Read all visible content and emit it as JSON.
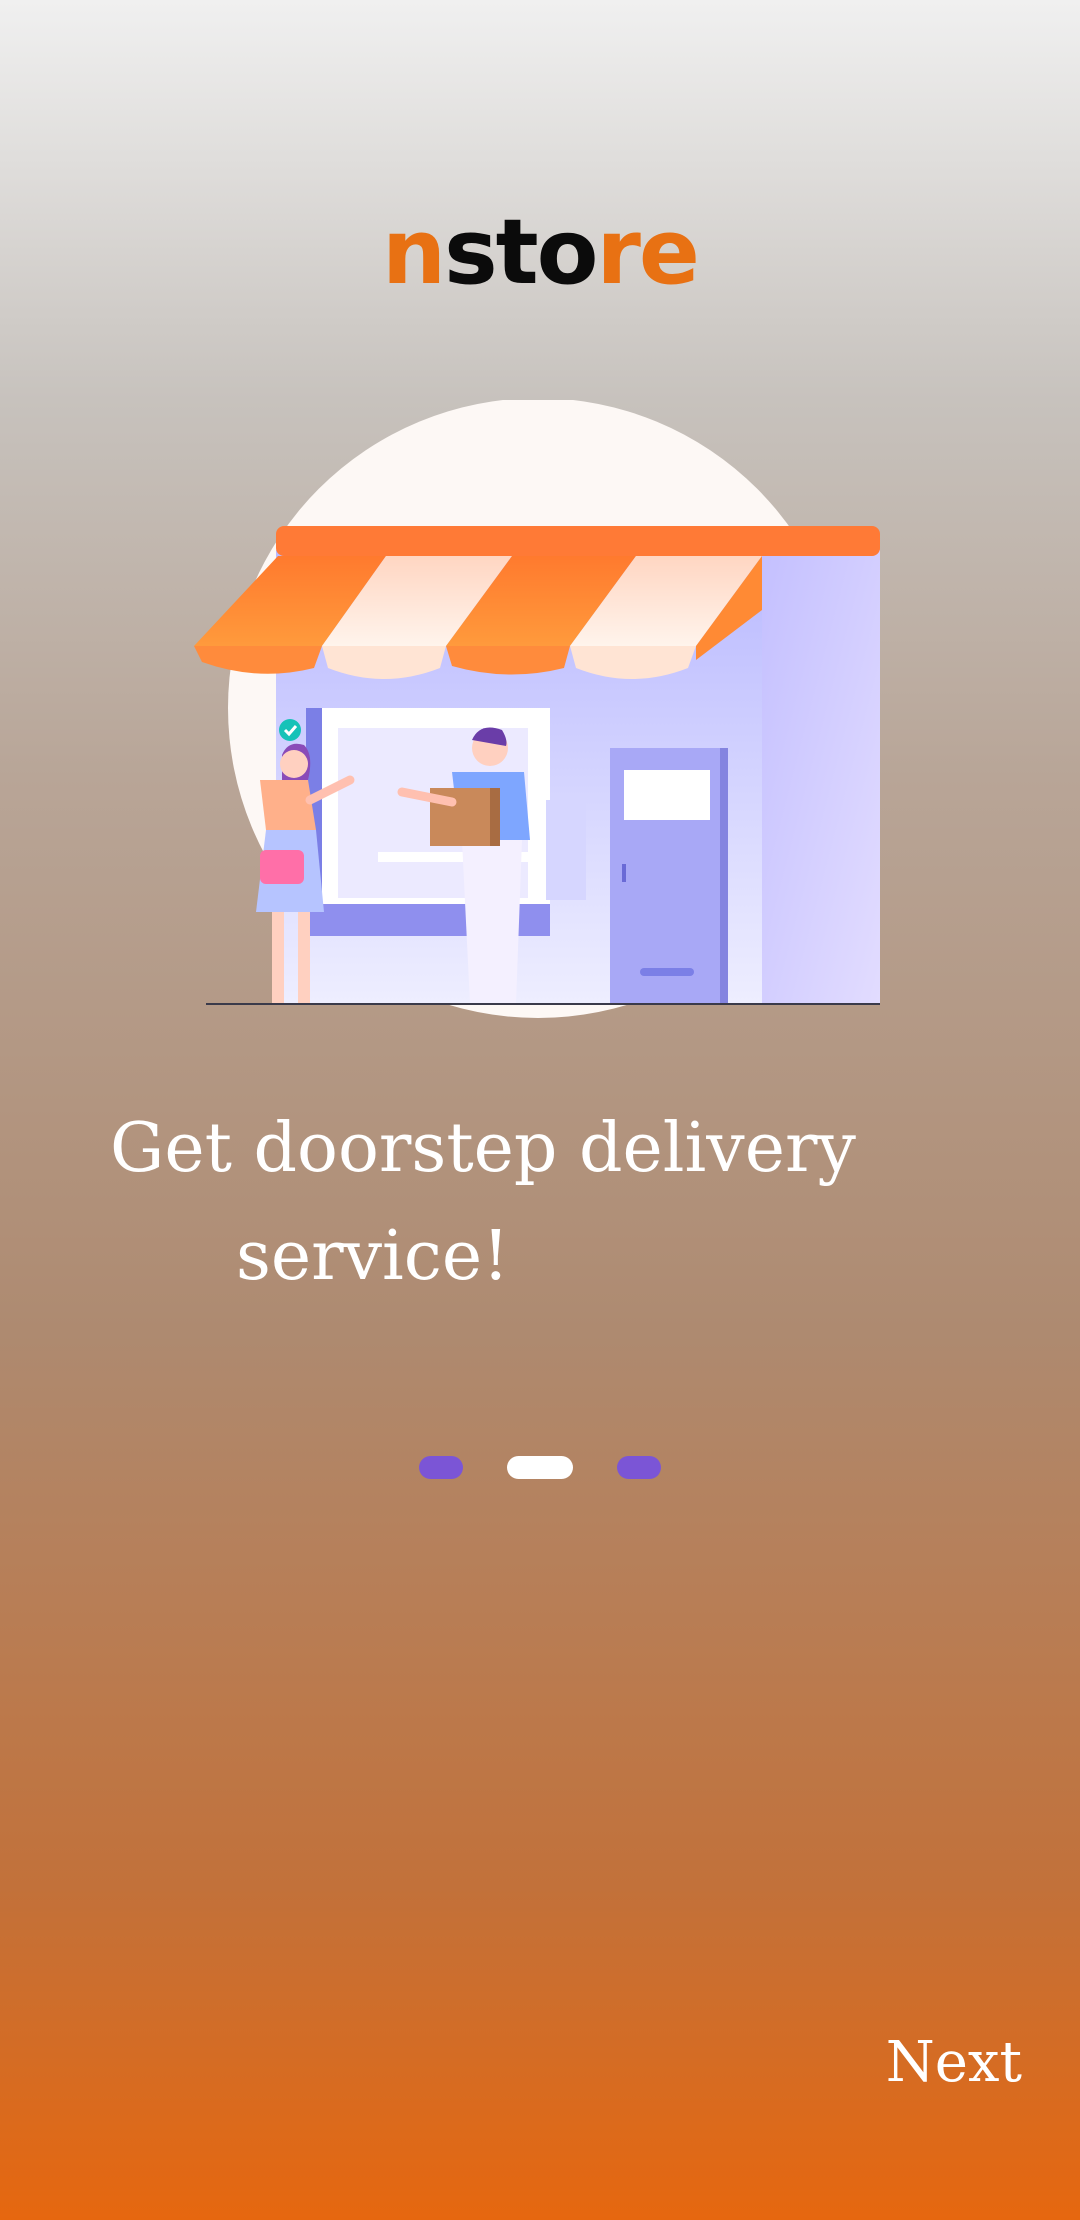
{
  "app": {
    "logo_part1": "n",
    "logo_part2": "sto",
    "logo_part3": "re"
  },
  "onboarding": {
    "headline_line1": "Get doorstep delivery",
    "headline_line2": "service!",
    "page_count": 3,
    "active_page": 2
  },
  "footer": {
    "next_label": "Next"
  },
  "colors": {
    "brand_orange": "#e87113",
    "indicator_inactive": "#7b55d6",
    "indicator_active": "#ffffff"
  },
  "icons": {
    "illustration": "store-delivery-illustration"
  }
}
